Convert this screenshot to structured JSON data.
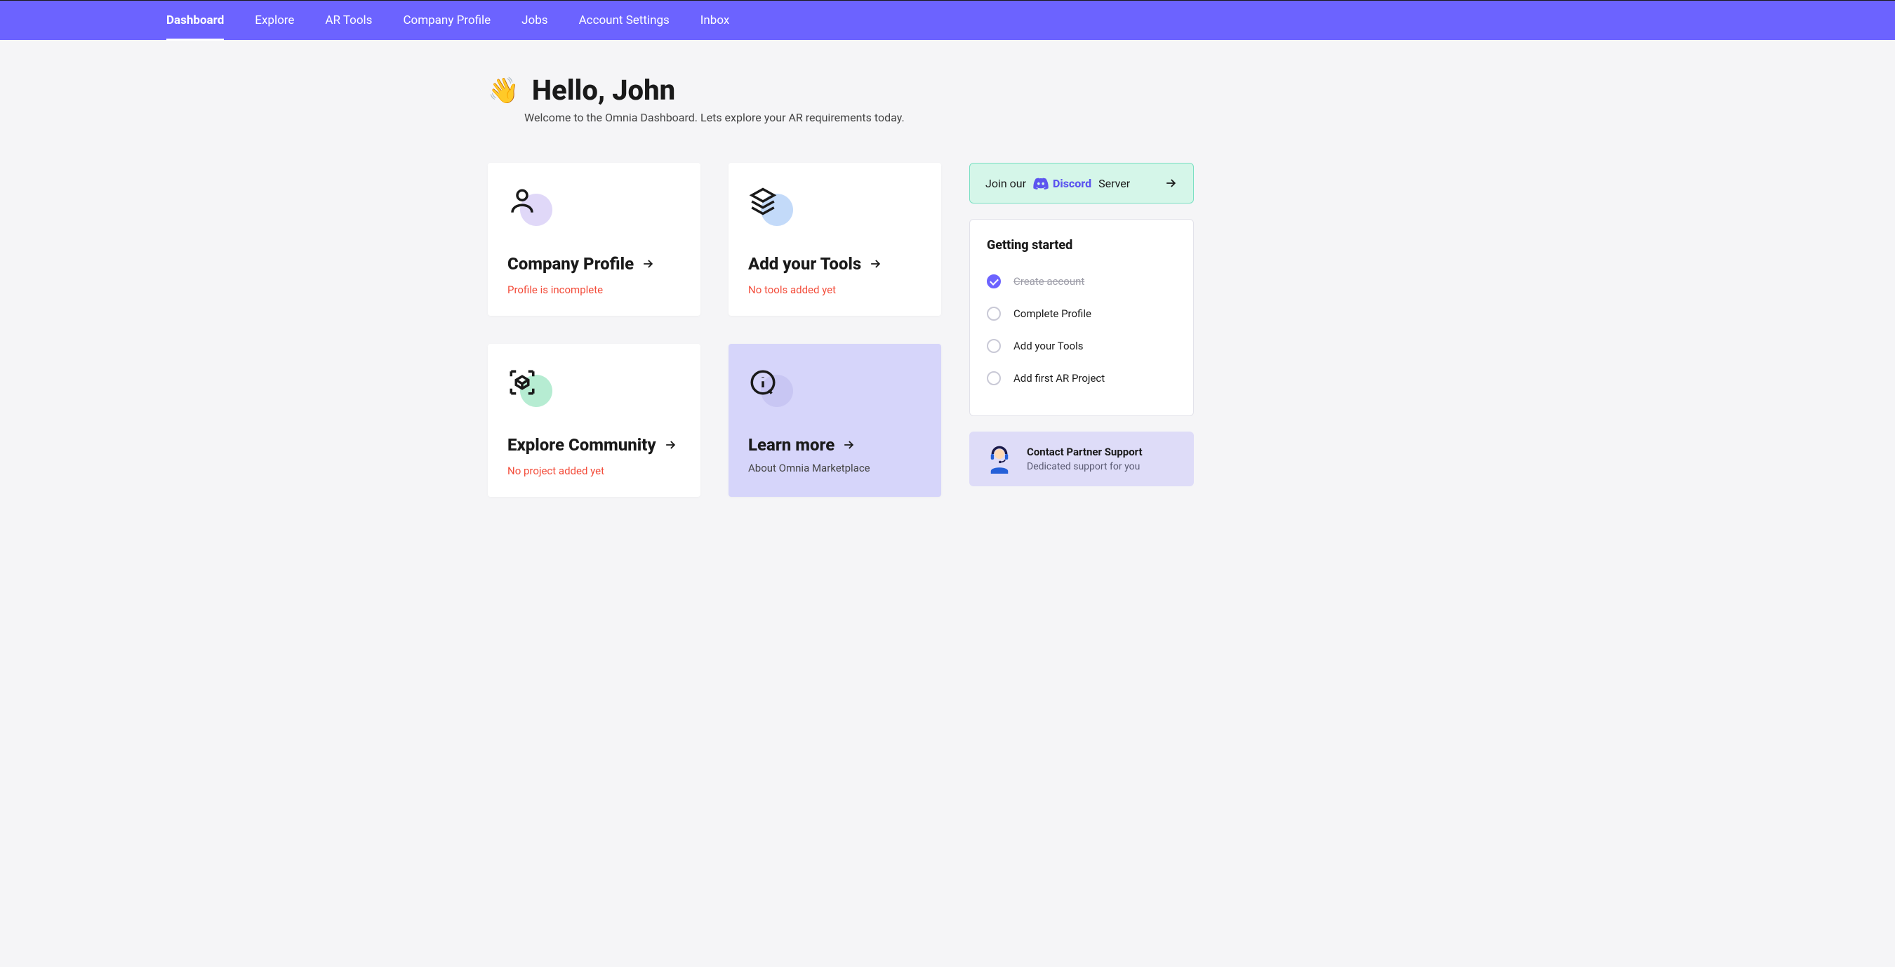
{
  "nav": {
    "items": [
      {
        "label": "Dashboard",
        "active": true
      },
      {
        "label": "Explore"
      },
      {
        "label": "AR Tools"
      },
      {
        "label": "Company Profile"
      },
      {
        "label": "Jobs"
      },
      {
        "label": "Account Settings"
      },
      {
        "label": "Inbox"
      }
    ]
  },
  "hero": {
    "greeting_emoji": "👋",
    "title": "Hello, John",
    "subtitle": "Welcome to the Omnia Dashboard. Lets explore your AR requirements today."
  },
  "cards": {
    "company": {
      "title": "Company Profile",
      "status": "Profile is incomplete"
    },
    "tools": {
      "title": "Add your Tools",
      "status": "No tools added yet"
    },
    "community": {
      "title": "Explore Community",
      "status": "No project added yet"
    },
    "learn": {
      "title": "Learn more",
      "subtitle": "About Omnia Marketplace"
    }
  },
  "discord": {
    "prefix": "Join our",
    "brand": "Discord",
    "suffix": "Server"
  },
  "getting_started": {
    "title": "Getting started",
    "items": [
      {
        "label": "Create account",
        "done": true
      },
      {
        "label": "Complete Profile",
        "done": false
      },
      {
        "label": "Add your Tools",
        "done": false
      },
      {
        "label": "Add first AR Project",
        "done": false
      }
    ]
  },
  "support": {
    "title": "Contact Partner Support",
    "subtitle": "Dedicated support for you"
  }
}
